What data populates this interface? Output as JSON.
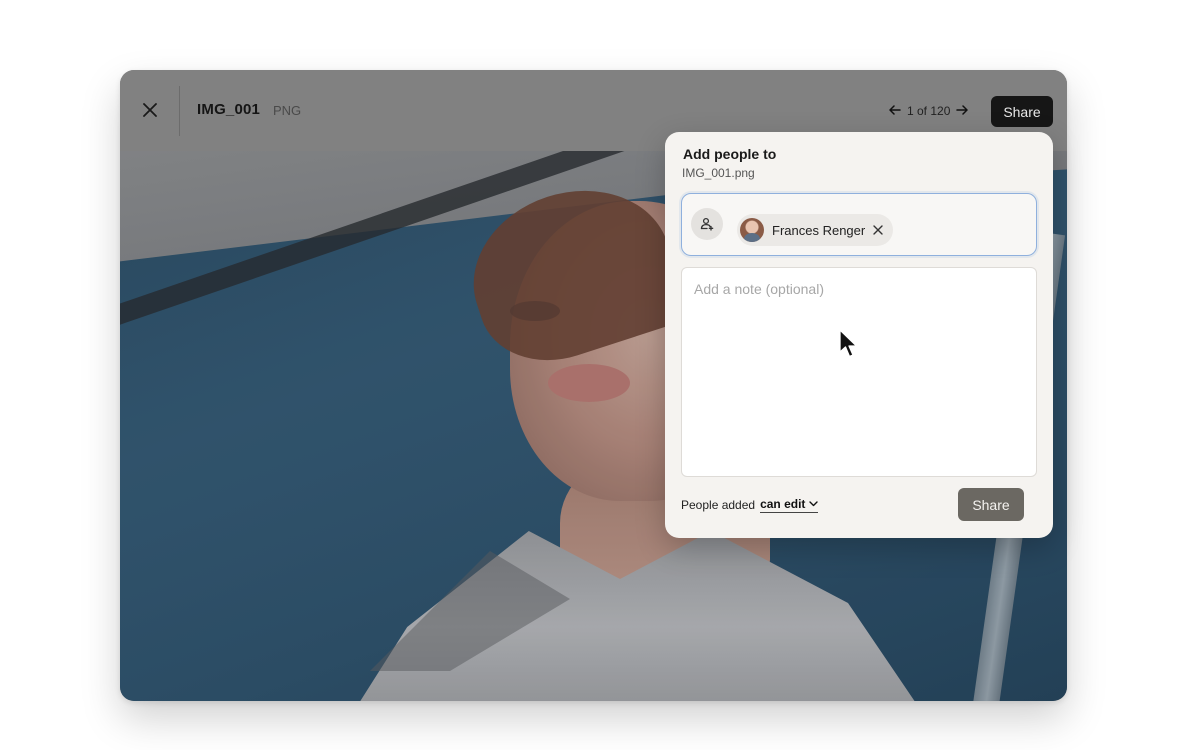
{
  "viewer": {
    "filename": "IMG_001",
    "filetype": "PNG",
    "pager": {
      "text": "1 of 120"
    },
    "share_label": "Share"
  },
  "dialog": {
    "title": "Add people to",
    "subtitle": "IMG_001.png",
    "recipients": [
      {
        "name": "Frances Renger"
      }
    ],
    "note_placeholder": "Add a note (optional)",
    "note_value": "",
    "permission_prefix": "People added",
    "permission_value": "can edit",
    "share_label": "Share"
  },
  "colors": {
    "focus_border": "#8fb0dd",
    "top_share_bg": "#161616",
    "dialog_share_bg": "#6b6862"
  },
  "icons": [
    "close-icon",
    "arrow-left-icon",
    "arrow-right-icon",
    "add-person-icon",
    "remove-icon",
    "chevron-down-icon",
    "mouse-pointer-icon"
  ]
}
